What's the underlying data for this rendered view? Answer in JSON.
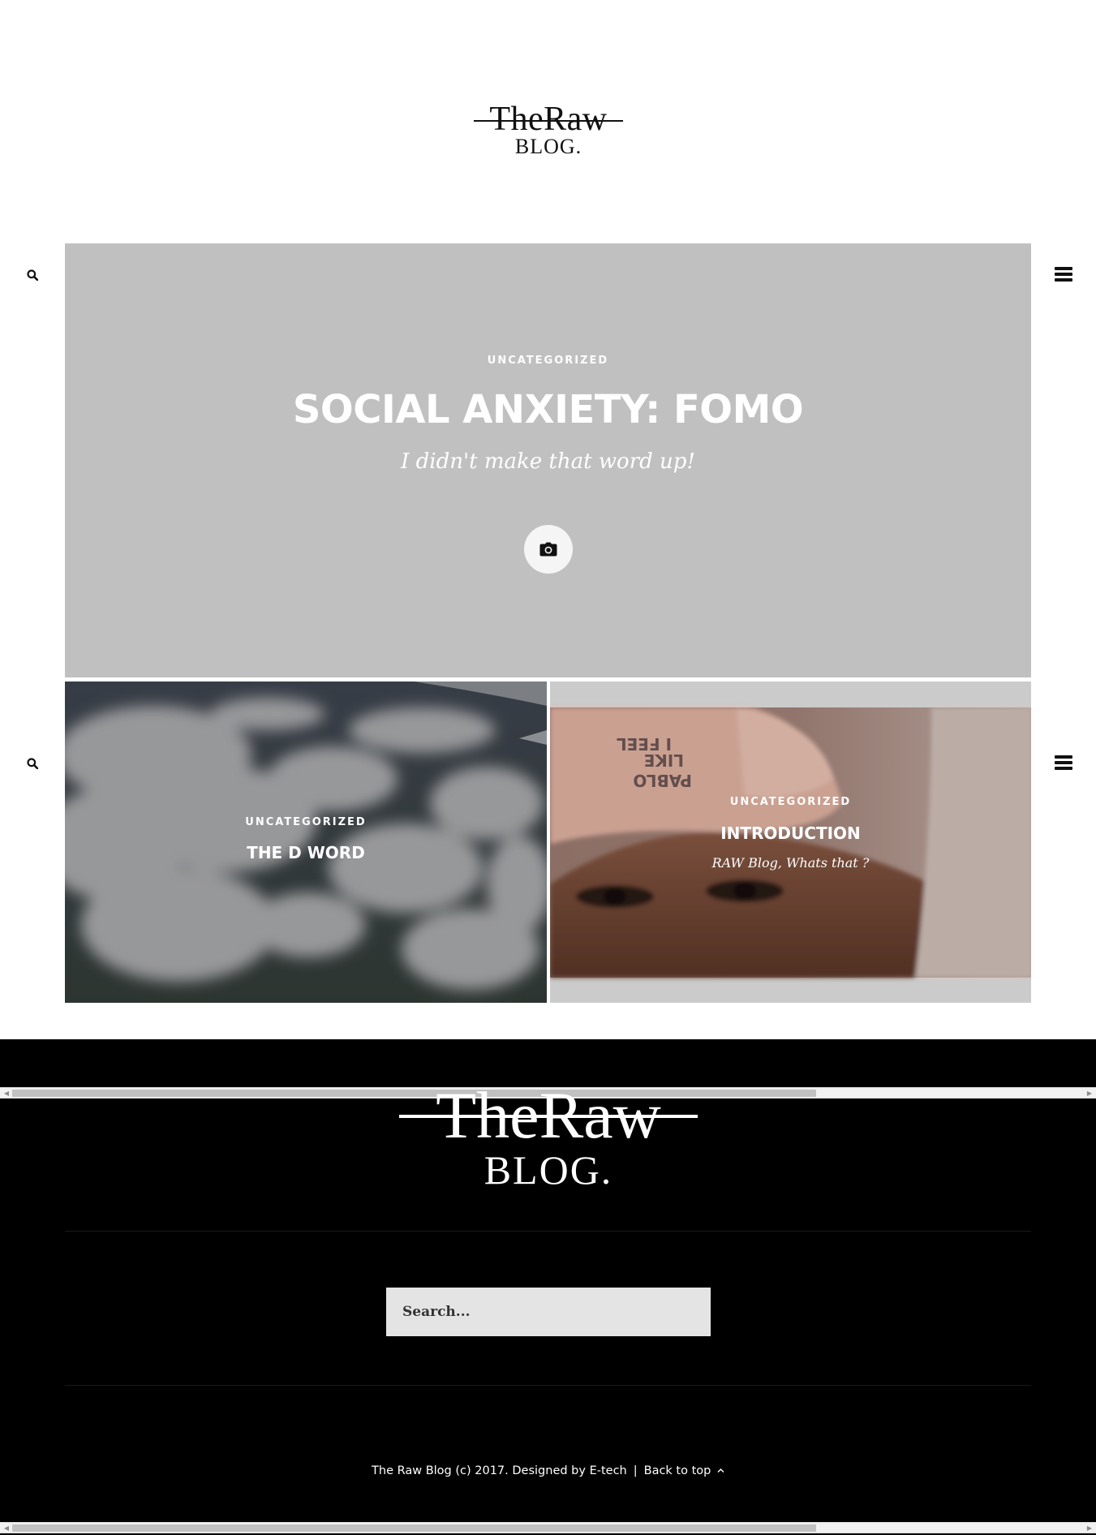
{
  "site": {
    "logo_top": "TheRaw",
    "logo_bottom": "BLOG."
  },
  "hero": {
    "category": "UNCATEGORIZED",
    "title": "SOCIAL ANXIETY: FOMO",
    "subtitle": "I didn't make that word up!",
    "media_icon": "camera-icon"
  },
  "posts": [
    {
      "category": "UNCATEGORIZED",
      "title": "THE D WORD",
      "image": "clouds-aerial-photo"
    },
    {
      "category": "UNCATEGORIZED",
      "title": "INTRODUCTION",
      "subtitle": "RAW Blog, Whats that ?",
      "image": "selfie-pink-cap-photo"
    }
  ],
  "side_icons": {
    "left": "search-icon",
    "right": "menu-icon"
  },
  "footer": {
    "logo_top": "TheRaw",
    "logo_bottom": "BLOG.",
    "search_placeholder": "Search...",
    "copyright": "The Raw Blog (c) 2017. Designed by E-tech",
    "separator": "|",
    "back_to_top": "Back to top",
    "back_to_top_icon": "chevron-up-icon"
  },
  "colors": {
    "hero_bg": "#c0c0c0",
    "footer_bg": "#000000",
    "search_bg": "#e4e4e4",
    "text_light": "#ffffff",
    "text_dark": "#111111"
  }
}
